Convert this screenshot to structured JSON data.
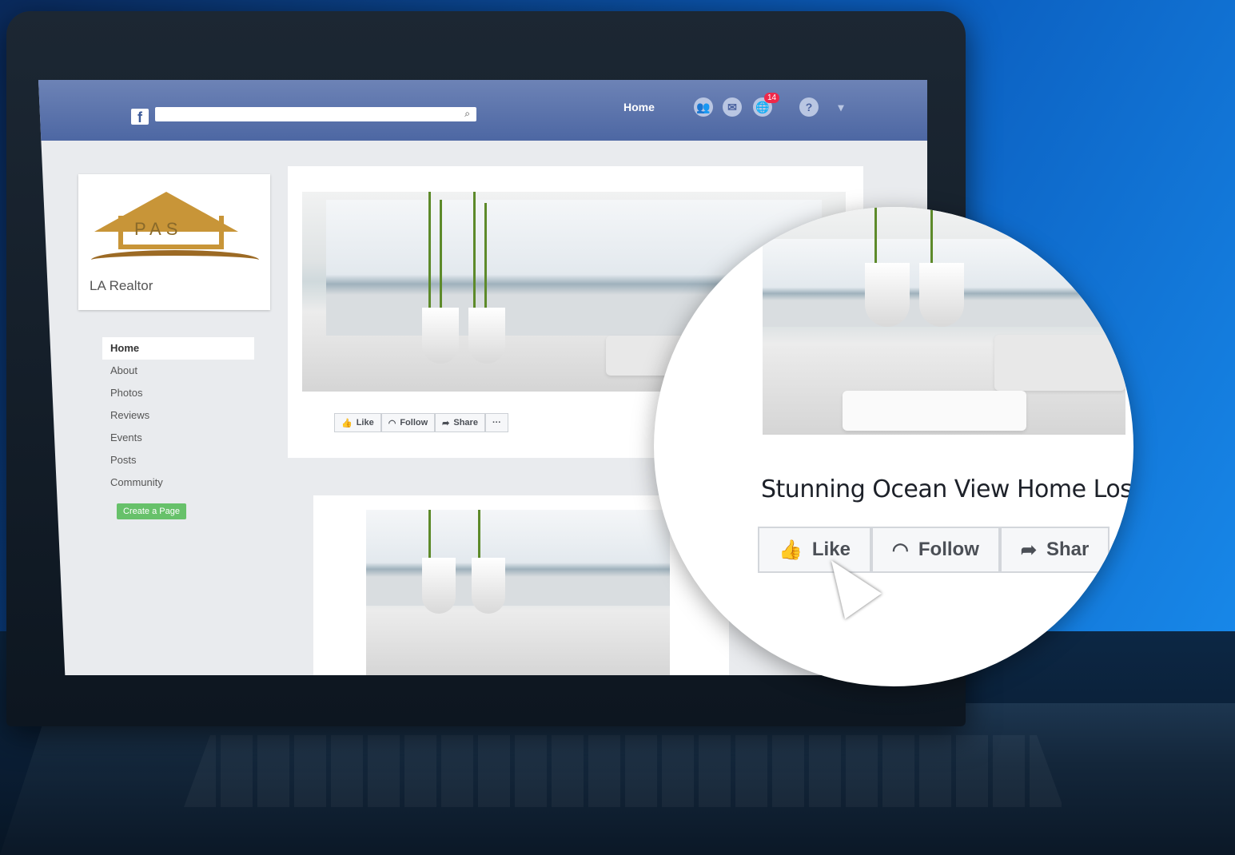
{
  "topbar": {
    "search_icon": "⌕",
    "nav_home": "Home",
    "notification_count": "14"
  },
  "page": {
    "logo_letters": "PAS",
    "logo_name": "LA Realtor",
    "sidebar": [
      "Home",
      "About",
      "Photos",
      "Reviews",
      "Events",
      "Posts",
      "Community"
    ],
    "create_page_button": "Create a Page"
  },
  "cover_actions": {
    "like": "Like",
    "follow": "Follow",
    "share": "Share",
    "more": "···"
  },
  "zoom": {
    "title": "Stunning Ocean View Home Los A",
    "like": "Like",
    "follow": "Follow",
    "share": "Shar"
  },
  "colors": {
    "facebook_blue": "#4d67a3",
    "create_green": "#67c16a",
    "badge_red": "#f02849"
  }
}
